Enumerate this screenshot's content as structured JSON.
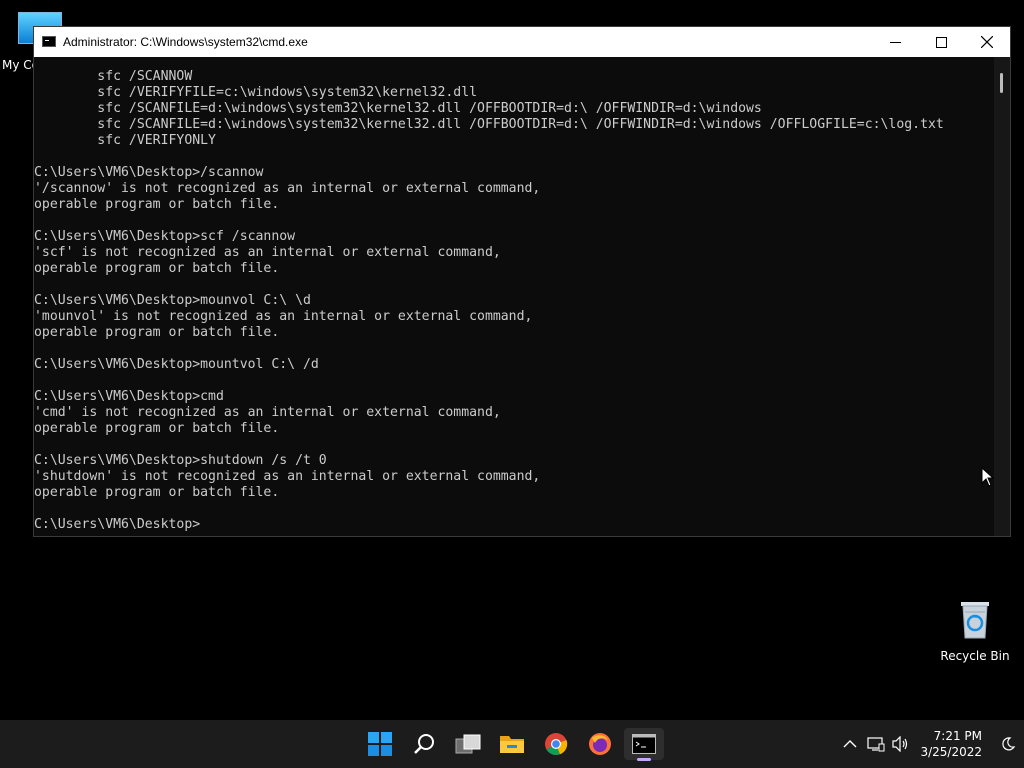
{
  "desktop": {
    "icons": [
      {
        "label": "My Co"
      },
      {
        "label": "Recycle Bin"
      }
    ]
  },
  "window": {
    "title": "Administrator: C:\\Windows\\system32\\cmd.exe",
    "controls": {
      "minimize": "─",
      "maximize": "☐",
      "close": "✕"
    },
    "terminal_lines": [
      "        sfc /SCANNOW",
      "        sfc /VERIFYFILE=c:\\windows\\system32\\kernel32.dll",
      "        sfc /SCANFILE=d:\\windows\\system32\\kernel32.dll /OFFBOOTDIR=d:\\ /OFFWINDIR=d:\\windows",
      "        sfc /SCANFILE=d:\\windows\\system32\\kernel32.dll /OFFBOOTDIR=d:\\ /OFFWINDIR=d:\\windows /OFFLOGFILE=c:\\log.txt",
      "        sfc /VERIFYONLY",
      "",
      "C:\\Users\\VM6\\Desktop>/scannow",
      "'/scannow' is not recognized as an internal or external command,",
      "operable program or batch file.",
      "",
      "C:\\Users\\VM6\\Desktop>scf /scannow",
      "'scf' is not recognized as an internal or external command,",
      "operable program or batch file.",
      "",
      "C:\\Users\\VM6\\Desktop>mounvol C:\\ \\d",
      "'mounvol' is not recognized as an internal or external command,",
      "operable program or batch file.",
      "",
      "C:\\Users\\VM6\\Desktop>mountvol C:\\ /d",
      "",
      "C:\\Users\\VM6\\Desktop>cmd",
      "'cmd' is not recognized as an internal or external command,",
      "operable program or batch file.",
      "",
      "C:\\Users\\VM6\\Desktop>shutdown /s /t 0",
      "'shutdown' is not recognized as an internal or external command,",
      "operable program or batch file.",
      "",
      "C:\\Users\\VM6\\Desktop>"
    ]
  },
  "taskbar": {
    "apps": [
      {
        "name": "start-icon"
      },
      {
        "name": "search-icon"
      },
      {
        "name": "task-view-icon"
      },
      {
        "name": "file-explorer-icon"
      },
      {
        "name": "chrome-icon"
      },
      {
        "name": "firefox-icon"
      },
      {
        "name": "terminal-icon",
        "active": true
      }
    ],
    "clock": {
      "time": "7:21 PM",
      "date": "3/25/2022"
    },
    "tray": {
      "chevron": "^",
      "network": "network-icon",
      "volume": "volume-icon",
      "focus": "moon-icon"
    }
  },
  "colors": {
    "terminal_bg": "#0c0c0c",
    "terminal_text": "#cccccc",
    "taskbar_bg": "#1c1c1c",
    "accent": "#0078d4"
  }
}
